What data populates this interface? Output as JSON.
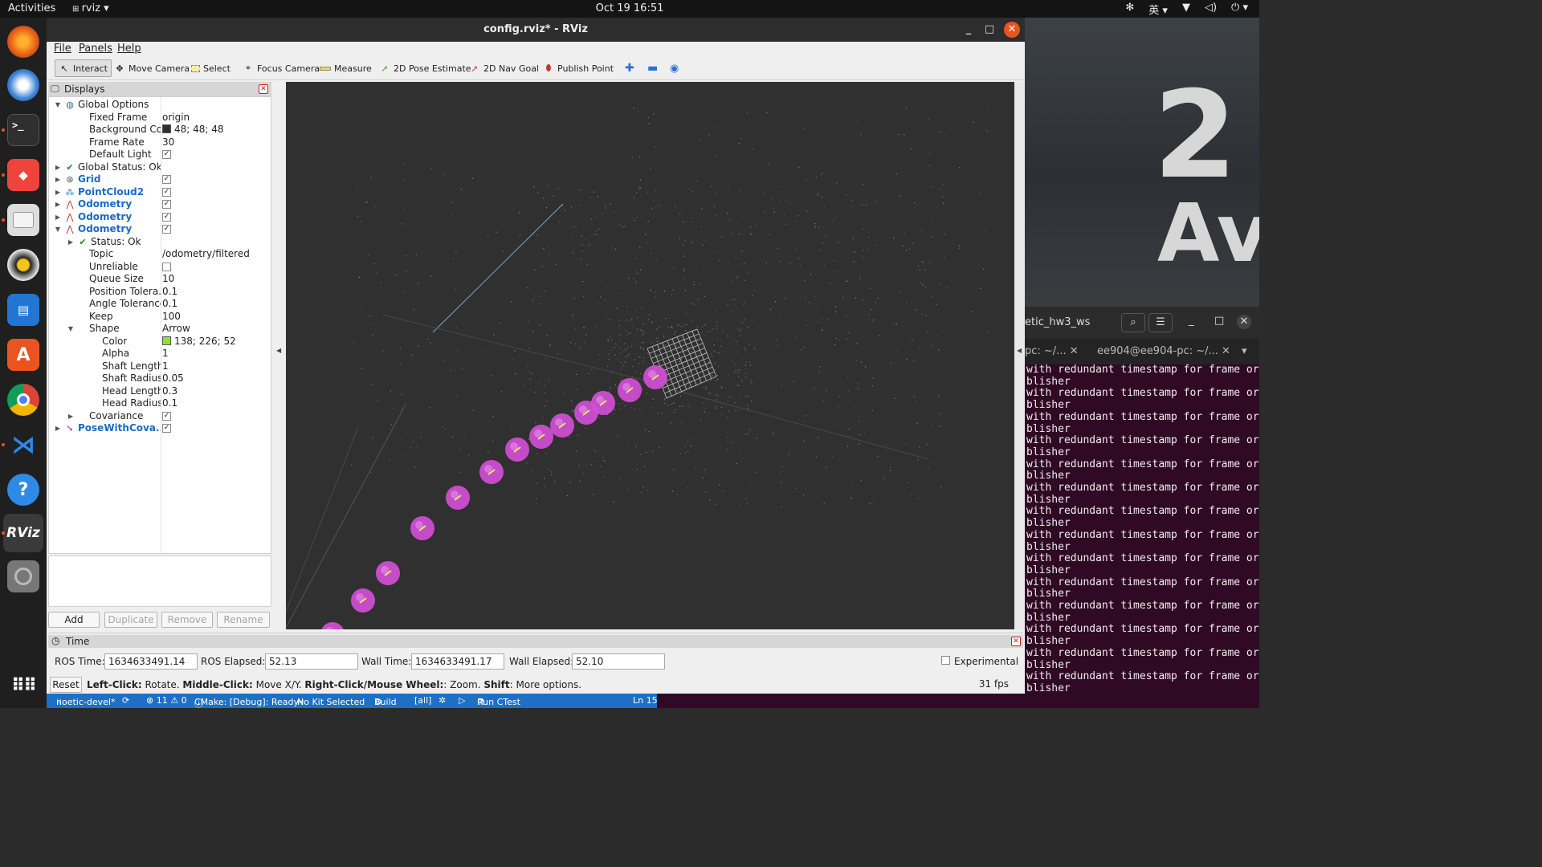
{
  "topbar": {
    "activities": "Activities",
    "app": "rviz ▾",
    "clock": "Oct 19  16:51",
    "ime": "英 ▾",
    "tray_icons": [
      "network-icon",
      "volume-icon",
      "power-icon"
    ]
  },
  "dock": {
    "apps": [
      "firefox",
      "thunderbird",
      "terminal",
      "anydesk",
      "files",
      "rhythmbox",
      "libreoffice-writer",
      "software",
      "chrome",
      "vscode",
      "help",
      "rviz",
      "disc",
      "app-grid"
    ],
    "rviz_label": "RViz"
  },
  "terminal": {
    "title": "etic_hw3_ws",
    "tab1": "pc: ~/...",
    "tab2": "ee904@ee904-pc: ~/...",
    "lines": [
      "with redundant timestamp for frame ori",
      "blisher",
      "with redundant timestamp for frame ori",
      "blisher",
      "with redundant timestamp for frame ori",
      "blisher",
      "with redundant timestamp for frame ori",
      "blisher",
      "with redundant timestamp for frame ori",
      "blisher",
      "with redundant timestamp for frame ori",
      "blisher",
      "with redundant timestamp for frame ori",
      "blisher",
      "with redundant timestamp for frame ori",
      "blisher",
      "with redundant timestamp for frame ori",
      "blisher",
      "with redundant timestamp for frame ori",
      "blisher",
      "with redundant timestamp for frame ori",
      "blisher",
      "with redundant timestamp for frame ori",
      "blisher",
      "with redundant timestamp for frame ori",
      "blisher",
      "with redundant timestamp for frame ori",
      "blisher"
    ]
  },
  "wallpaper": {
    "digit": "2",
    "text": "Ave"
  },
  "window": {
    "title": "config.rviz* - RViz",
    "menu": [
      "File",
      "Panels",
      "Help"
    ]
  },
  "toolbar": {
    "interact": "Interact",
    "move_camera": "Move Camera",
    "select": "Select",
    "focus_camera": "Focus Camera",
    "measure": "Measure",
    "pose_estimate": "2D Pose Estimate",
    "nav_goal": "2D Nav Goal",
    "publish_point": "Publish Point"
  },
  "displays": {
    "title": "Displays",
    "buttons": {
      "add": "Add",
      "duplicate": "Duplicate",
      "remove": "Remove",
      "rename": "Rename"
    },
    "rows": [
      {
        "name": "Global Options",
        "indent": 0,
        "arrow": "down",
        "icon": "globe-icon"
      },
      {
        "name": "Fixed Frame",
        "value": "origin",
        "indent": 1
      },
      {
        "name": "Background Color",
        "value": "48; 48; 48",
        "swatch": "#303030",
        "indent": 1
      },
      {
        "name": "Frame Rate",
        "value": "30",
        "indent": 1
      },
      {
        "name": "Default Light",
        "check": true,
        "indent": 1
      },
      {
        "name": "Global Status: Ok",
        "indent": 0,
        "arrow": "right",
        "icon": "check-icon"
      },
      {
        "name": "Grid",
        "check": true,
        "indent": 0,
        "arrow": "right",
        "icon": "grid-icon",
        "blue": true
      },
      {
        "name": "PointCloud2",
        "check": true,
        "indent": 0,
        "arrow": "right",
        "icon": "pointcloud-icon",
        "blue": true
      },
      {
        "name": "Odometry",
        "check": true,
        "indent": 0,
        "arrow": "right",
        "icon": "odometry-icon",
        "blue": true
      },
      {
        "name": "Odometry",
        "check": true,
        "indent": 0,
        "arrow": "right",
        "icon": "odometry-icon",
        "blue": true
      },
      {
        "name": "Odometry",
        "check": true,
        "indent": 0,
        "arrow": "down",
        "icon": "odometry-icon",
        "blue": true
      },
      {
        "name": "Status: Ok",
        "indent": 1,
        "arrow": "right",
        "icon": "check-icon"
      },
      {
        "name": "Topic",
        "value": "/odometry/filtered",
        "indent": 1
      },
      {
        "name": "Unreliable",
        "check": false,
        "indent": 1
      },
      {
        "name": "Queue Size",
        "value": "10",
        "indent": 1
      },
      {
        "name": "Position Tolera...",
        "value": "0.1",
        "indent": 1
      },
      {
        "name": "Angle Tolerance",
        "value": "0.1",
        "indent": 1
      },
      {
        "name": "Keep",
        "value": "100",
        "indent": 1
      },
      {
        "name": "Shape",
        "value": "Arrow",
        "indent": 1,
        "arrow": "down"
      },
      {
        "name": "Color",
        "value": "138; 226; 52",
        "swatch": "#8ae234",
        "indent": 2
      },
      {
        "name": "Alpha",
        "value": "1",
        "indent": 2
      },
      {
        "name": "Shaft Length",
        "value": "1",
        "indent": 2
      },
      {
        "name": "Shaft Radius",
        "value": "0.05",
        "indent": 2
      },
      {
        "name": "Head Length",
        "value": "0.3",
        "indent": 2
      },
      {
        "name": "Head Radius",
        "value": "0.1",
        "indent": 2
      },
      {
        "name": "Covariance",
        "check": true,
        "indent": 1,
        "arrow": "right"
      },
      {
        "name": "PoseWithCova...",
        "check": true,
        "indent": 0,
        "arrow": "right",
        "icon": "pose-icon",
        "blue": true
      }
    ]
  },
  "time": {
    "title": "Time",
    "ros_time_label": "ROS Time:",
    "ros_time": "1634633491.14",
    "ros_elapsed_label": "ROS Elapsed:",
    "ros_elapsed": "52.13",
    "wall_time_label": "Wall Time:",
    "wall_time": "1634633491.17",
    "wall_elapsed_label": "Wall Elapsed:",
    "wall_elapsed": "52.10",
    "experimental": "Experimental",
    "reset": "Reset",
    "help_b1": "Left-Click:",
    "help_t1": " Rotate. ",
    "help_b2": "Middle-Click:",
    "help_t2": " Move X/Y. ",
    "help_b3": "Right-Click/Mouse Wheel:",
    "help_t3": ": Zoom. ",
    "help_b4": "Shift",
    "help_t4": ": More options.",
    "fps": "31 fps"
  },
  "vscode": {
    "branch": "noetic-devel*",
    "problems": "⊗ 11 ⚠ 0",
    "cmake": "CMake: [Debug]: Ready",
    "kit": "No Kit Selected",
    "build": "Build",
    "all": "[all]",
    "ctest": "Run CTest",
    "ln": "Ln 15"
  },
  "scene": {
    "pose_marker_color": "#d24fd6",
    "arrow_color": "#e8f060",
    "cloud_color": "#9a9a9a",
    "grid_color": "#cfcfcf",
    "pose_markers_count": 13
  }
}
